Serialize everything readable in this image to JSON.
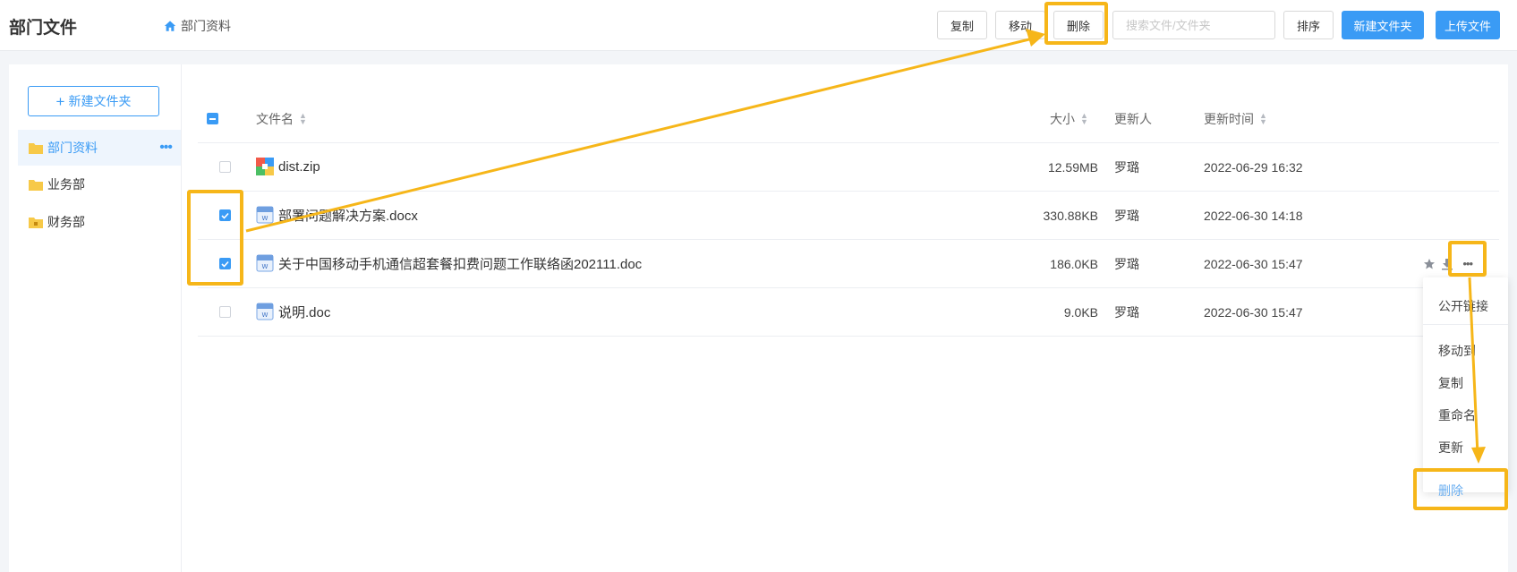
{
  "header": {
    "title": "部门文件",
    "breadcrumb": "部门资料",
    "buttons": {
      "copy": "复制",
      "move": "移动",
      "delete": "删除",
      "sort": "排序",
      "new_folder": "新建文件夹",
      "upload": "上传文件"
    },
    "search_placeholder": "搜索文件/文件夹"
  },
  "sidebar": {
    "new_folder_label": "新建文件夹",
    "folders": [
      {
        "label": "部门资料",
        "active": true
      },
      {
        "label": "业务部",
        "active": false
      },
      {
        "label": "财务部",
        "active": false
      }
    ]
  },
  "table": {
    "columns": {
      "name": "文件名",
      "size": "大小",
      "updater": "更新人",
      "updated_time": "更新时间"
    },
    "rows": [
      {
        "name": "dist.zip",
        "size": "12.59MB",
        "updater": "罗璐",
        "time": "2022-06-29 16:32",
        "checked": false,
        "type": "zip"
      },
      {
        "name": "部署问题解决方案.docx",
        "size": "330.88KB",
        "updater": "罗璐",
        "time": "2022-06-30 14:18",
        "checked": true,
        "type": "doc"
      },
      {
        "name": "关于中国移动手机通信超套餐扣费问题工作联络函202111.doc",
        "size": "186.0KB",
        "updater": "罗璐",
        "time": "2022-06-30 15:47",
        "checked": true,
        "type": "doc"
      },
      {
        "name": "说明.doc",
        "size": "9.0KB",
        "updater": "罗璐",
        "time": "2022-06-30 15:47",
        "checked": false,
        "type": "doc"
      }
    ]
  },
  "context_menu": {
    "items": [
      "公开链接",
      "移动到",
      "复制",
      "重命名",
      "更新",
      "删除"
    ]
  },
  "colors": {
    "primary": "#3a9bf5",
    "highlight": "#f6b619"
  }
}
